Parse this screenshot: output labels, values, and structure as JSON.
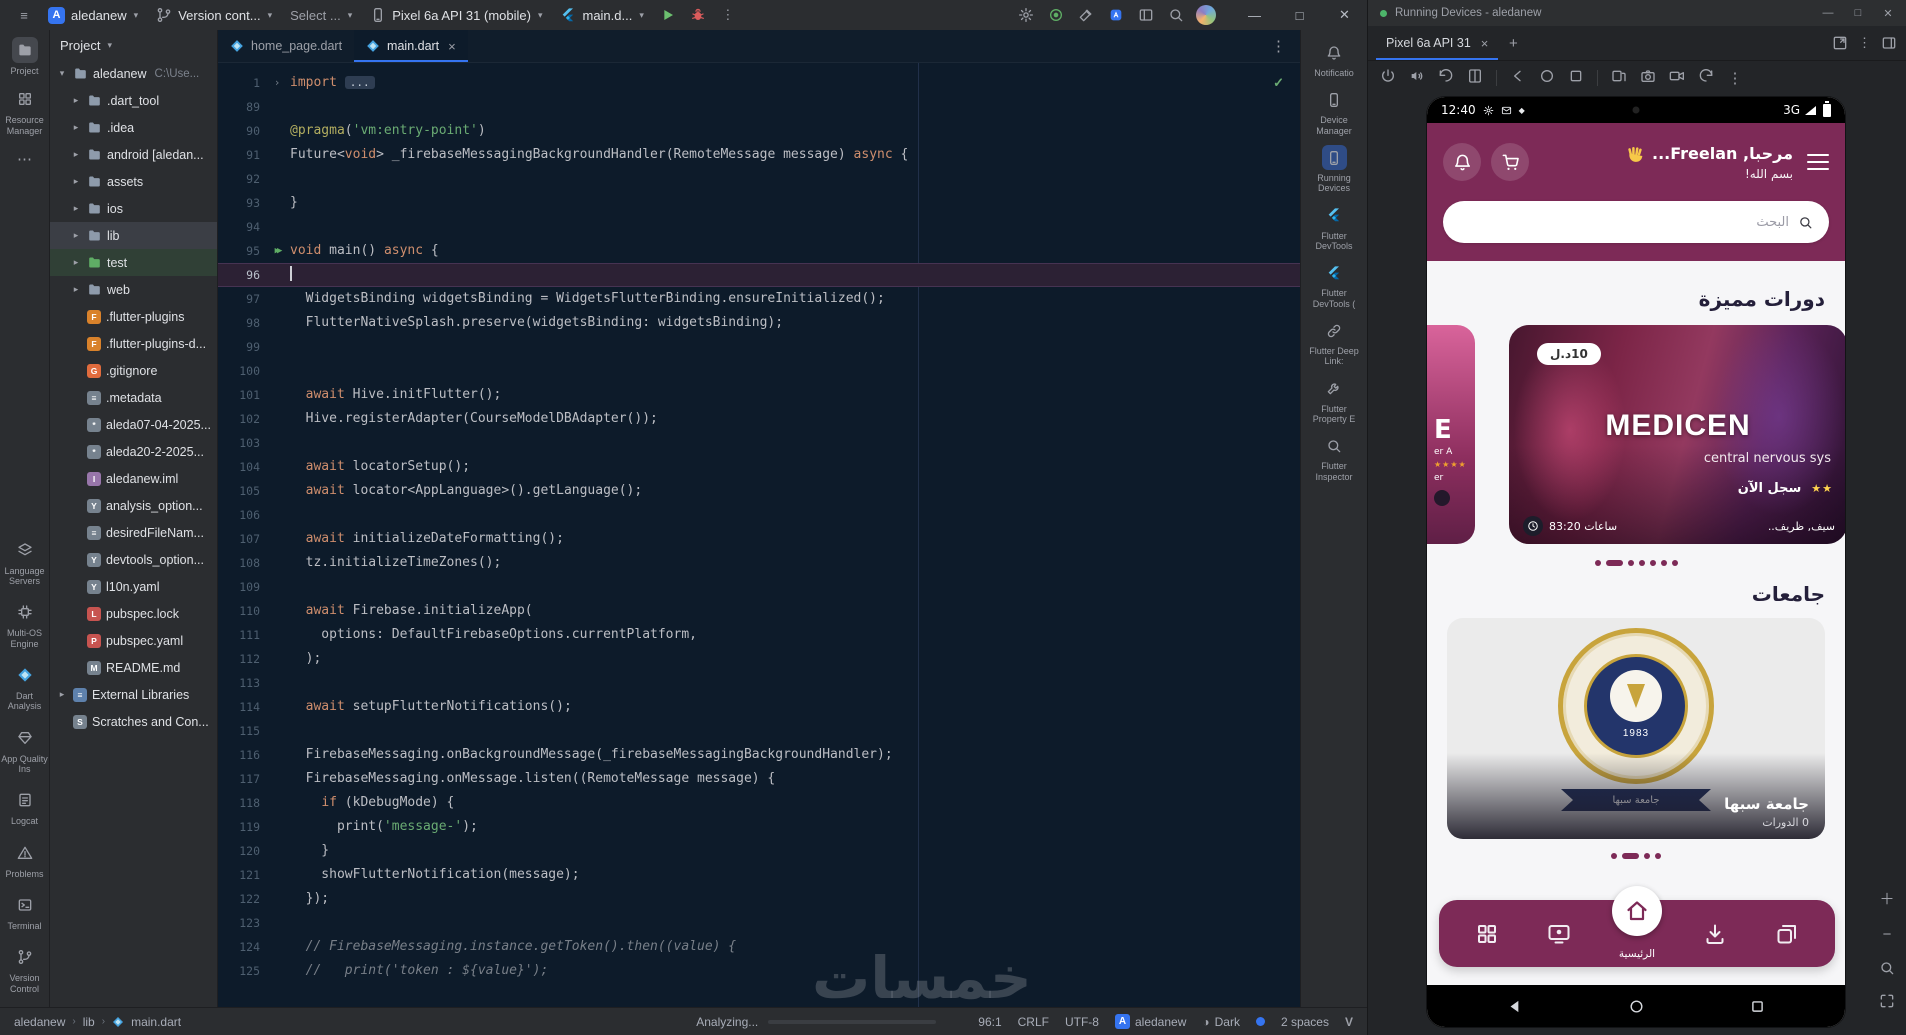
{
  "titlebar": {
    "app_initial": "A",
    "project": "aledanew",
    "branch": "Version cont...",
    "run_target": "Select ...",
    "device": "Pixel 6a API 31 (mobile)",
    "config": "main.d..."
  },
  "left_strip": {
    "top": [
      {
        "id": "project",
        "label": "Project",
        "icon": "folder",
        "active": true
      },
      {
        "id": "resource-manager",
        "label": "Resource Manager",
        "icon": "grid4"
      },
      {
        "id": "more-tool-windows",
        "label": "",
        "icon": "dots"
      }
    ],
    "bottom": [
      {
        "id": "language-servers",
        "label": "Language Servers",
        "icon": "layers"
      },
      {
        "id": "multi-os-engine",
        "label": "Multi-OS Engine",
        "icon": "chip"
      },
      {
        "id": "dart-analysis",
        "label": "Dart Analysis",
        "icon": "dartfile"
      },
      {
        "id": "app-quality-insights",
        "label": "App Quality Ins",
        "icon": "gem"
      },
      {
        "id": "logcat",
        "label": "Logcat",
        "icon": "logdoc"
      },
      {
        "id": "problems",
        "label": "Problems",
        "icon": "warn"
      },
      {
        "id": "terminal",
        "label": "Terminal",
        "icon": "term"
      },
      {
        "id": "version-control",
        "label": "Version Control",
        "icon": "branch"
      }
    ]
  },
  "project": {
    "header": "Project",
    "tree": [
      {
        "label": "aledanew",
        "suffix": "C:\\Use...",
        "depth": 0,
        "chev": "▾",
        "icon": "folder"
      },
      {
        "label": ".dart_tool",
        "depth": 1,
        "chev": "▸",
        "icon": "folder"
      },
      {
        "label": ".idea",
        "depth": 1,
        "chev": "▸",
        "icon": "folder"
      },
      {
        "label": "android [aledan...",
        "depth": 1,
        "chev": "▸",
        "icon": "folder"
      },
      {
        "label": "assets",
        "depth": 1,
        "chev": "▸",
        "icon": "folder"
      },
      {
        "label": "ios",
        "depth": 1,
        "chev": "▸",
        "icon": "folder"
      },
      {
        "label": "lib",
        "depth": 1,
        "chev": "▸",
        "icon": "folder",
        "state": "selected"
      },
      {
        "label": "test",
        "depth": 1,
        "chev": "▸",
        "icon": "folder-test",
        "state": "test"
      },
      {
        "label": "web",
        "depth": 1,
        "chev": "▸",
        "icon": "folder"
      },
      {
        "label": ".flutter-plugins",
        "depth": 1,
        "icon": "plug"
      },
      {
        "label": ".flutter-plugins-d...",
        "depth": 1,
        "icon": "plug"
      },
      {
        "label": ".gitignore",
        "depth": 1,
        "icon": "git"
      },
      {
        "label": ".metadata",
        "depth": 1,
        "icon": "file"
      },
      {
        "label": "aleda07-04-2025...",
        "depth": 1,
        "icon": "key"
      },
      {
        "label": "aleda20-2-2025...",
        "depth": 1,
        "icon": "key"
      },
      {
        "label": "aledanew.iml",
        "depth": 1,
        "icon": "iml"
      },
      {
        "label": "analysis_option...",
        "depth": 1,
        "icon": "yaml"
      },
      {
        "label": "desiredFileNam...",
        "depth": 1,
        "icon": "file"
      },
      {
        "label": "devtools_option...",
        "depth": 1,
        "icon": "yaml"
      },
      {
        "label": "l10n.yaml",
        "depth": 1,
        "icon": "yaml"
      },
      {
        "label": "pubspec.lock",
        "depth": 1,
        "icon": "lock"
      },
      {
        "label": "pubspec.yaml",
        "depth": 1,
        "icon": "pub"
      },
      {
        "label": "README.md",
        "depth": 1,
        "icon": "md"
      },
      {
        "label": "External Libraries",
        "depth": 0,
        "chev": "▸",
        "icon": "libs"
      },
      {
        "label": "Scratches and Con...",
        "depth": 0,
        "icon": "scratch"
      }
    ]
  },
  "editor": {
    "tabs": [
      {
        "label": "home_page.dart",
        "active": false,
        "closable": false
      },
      {
        "label": "main.dart",
        "active": true,
        "closable": true
      }
    ],
    "inspection_ok": "✓",
    "lines": [
      {
        "n": 1,
        "g": "fold",
        "tk": [
          [
            "import ",
            "k"
          ],
          [
            "...",
            "f"
          ]
        ]
      },
      {
        "n": 89,
        "tk": []
      },
      {
        "n": 90,
        "tk": [
          [
            "@pragma",
            "a"
          ],
          [
            "(",
            "d"
          ],
          [
            "'vm:entry-point'",
            "s"
          ],
          [
            ")",
            "d"
          ]
        ]
      },
      {
        "n": 91,
        "tk": [
          [
            "Future<",
            "d"
          ],
          [
            "void",
            "k"
          ],
          [
            "> _firebaseMessagingBackgroundHandler(RemoteMessage message) ",
            "d"
          ],
          [
            "async",
            "k"
          ],
          [
            " {",
            "d"
          ]
        ]
      },
      {
        "n": 92,
        "tk": []
      },
      {
        "n": 93,
        "tk": [
          [
            "}",
            "d"
          ]
        ]
      },
      {
        "n": 94,
        "tk": []
      },
      {
        "n": 95,
        "g": "run",
        "tk": [
          [
            "void",
            "k"
          ],
          [
            " main() ",
            "d"
          ],
          [
            "async",
            "k"
          ],
          [
            " {",
            "d"
          ]
        ]
      },
      {
        "n": 96,
        "cur": true,
        "tk": []
      },
      {
        "n": 97,
        "tk": [
          [
            "  WidgetsBinding widgetsBinding = WidgetsFlutterBinding.ensureInitialized();",
            "d"
          ]
        ]
      },
      {
        "n": 98,
        "tk": [
          [
            "  FlutterNativeSplash.preserve(widgetsBinding: widgetsBinding);",
            "d"
          ]
        ]
      },
      {
        "n": 99,
        "tk": []
      },
      {
        "n": 100,
        "tk": []
      },
      {
        "n": 101,
        "tk": [
          [
            "  ",
            "d"
          ],
          [
            "await",
            "k"
          ],
          [
            " Hive.initFlutter();",
            "d"
          ]
        ]
      },
      {
        "n": 102,
        "tk": [
          [
            "  Hive.registerAdapter(CourseModelDBAdapter());",
            "d"
          ]
        ]
      },
      {
        "n": 103,
        "tk": []
      },
      {
        "n": 104,
        "tk": [
          [
            "  ",
            "d"
          ],
          [
            "await",
            "k"
          ],
          [
            " locatorSetup();",
            "d"
          ]
        ]
      },
      {
        "n": 105,
        "tk": [
          [
            "  ",
            "d"
          ],
          [
            "await",
            "k"
          ],
          [
            " locator<AppLanguage>().getLanguage();",
            "d"
          ]
        ]
      },
      {
        "n": 106,
        "tk": []
      },
      {
        "n": 107,
        "tk": [
          [
            "  ",
            "d"
          ],
          [
            "await",
            "k"
          ],
          [
            " initializeDateFormatting();",
            "d"
          ]
        ]
      },
      {
        "n": 108,
        "tk": [
          [
            "  tz.initializeTimeZones();",
            "d"
          ]
        ]
      },
      {
        "n": 109,
        "tk": []
      },
      {
        "n": 110,
        "tk": [
          [
            "  ",
            "d"
          ],
          [
            "await",
            "k"
          ],
          [
            " Firebase.initializeApp(",
            "d"
          ]
        ]
      },
      {
        "n": 111,
        "tk": [
          [
            "    options: DefaultFirebaseOptions.currentPlatform,",
            "d"
          ]
        ]
      },
      {
        "n": 112,
        "tk": [
          [
            "  );",
            "d"
          ]
        ]
      },
      {
        "n": 113,
        "tk": []
      },
      {
        "n": 114,
        "tk": [
          [
            "  ",
            "d"
          ],
          [
            "await",
            "k"
          ],
          [
            " setupFlutterNotifications();",
            "d"
          ]
        ]
      },
      {
        "n": 115,
        "tk": []
      },
      {
        "n": 116,
        "tk": [
          [
            "  FirebaseMessaging.onBackgroundMessage(_firebaseMessagingBackgroundHandler);",
            "d"
          ]
        ]
      },
      {
        "n": 117,
        "tk": [
          [
            "  FirebaseMessaging.onMessage.listen((RemoteMessage message) {",
            "d"
          ]
        ]
      },
      {
        "n": 118,
        "tk": [
          [
            "    ",
            "d"
          ],
          [
            "if",
            "k"
          ],
          [
            " (kDebugMode) {",
            "d"
          ]
        ]
      },
      {
        "n": 119,
        "tk": [
          [
            "      print(",
            "d"
          ],
          [
            "'message-'",
            "s"
          ],
          [
            ");",
            "d"
          ]
        ]
      },
      {
        "n": 120,
        "tk": [
          [
            "    }",
            "d"
          ]
        ]
      },
      {
        "n": 121,
        "tk": [
          [
            "    showFlutterNotification(message);",
            "d"
          ]
        ]
      },
      {
        "n": 122,
        "tk": [
          [
            "  });",
            "d"
          ]
        ]
      },
      {
        "n": 123,
        "tk": []
      },
      {
        "n": 124,
        "tk": [
          [
            "  // FirebaseMessaging.instance.getToken().then((value) {",
            "c"
          ]
        ]
      },
      {
        "n": 125,
        "tk": [
          [
            "  //   print('token : ${value}');",
            "c"
          ]
        ]
      }
    ]
  },
  "status_bar": {
    "breadcrumbs": [
      "aledanew",
      "lib",
      "main.dart"
    ],
    "analyzing": "Analyzing...",
    "caret": "96:1",
    "line_ending": "CRLF",
    "encoding": "UTF-8",
    "project_badge": "A",
    "project": "aledanew",
    "theme": "Dark",
    "indent": "2 spaces",
    "plugin": "V"
  },
  "right_strip": {
    "items": [
      {
        "id": "notifications",
        "label": "Notificatio",
        "icon": "bell"
      },
      {
        "id": "device-manager",
        "label": "Device Manager",
        "icon": "phone"
      },
      {
        "id": "running-devices",
        "label": "Running Devices",
        "icon": "phone",
        "active": true
      },
      {
        "id": "flutter-devtools",
        "label": "Flutter DevTools",
        "icon": "flutter"
      },
      {
        "id": "flutter-devtools-2",
        "label": "Flutter DevTools (",
        "icon": "flutter"
      },
      {
        "id": "flutter-deep-links",
        "label": "Flutter Deep Link:",
        "icon": "link"
      },
      {
        "id": "flutter-property-editor",
        "label": "Flutter Property E",
        "icon": "wrench"
      },
      {
        "id": "flutter-inspector",
        "label": "Flutter Inspector",
        "icon": "search"
      }
    ]
  },
  "device_panel": {
    "title": "Running Devices - aledanew",
    "tab": "Pixel 6a API 31",
    "toolbar": [
      "power",
      "volume",
      "rotate",
      "fold",
      "back",
      "home-round",
      "overview",
      "mirror",
      "screenshot",
      "record",
      "restart",
      "more"
    ],
    "separators_after": [
      3,
      6
    ],
    "phone": {
      "time": "12:40",
      "network": "3G",
      "status_icons": [
        "gear",
        "mail",
        "diamond"
      ],
      "greeting": "مرحبا, Freelan...",
      "sub_greeting": "بسم الله!",
      "search_placeholder": "البحث",
      "featured_title": "دورات مميزة",
      "card": {
        "price": "10د.ل",
        "title": "MEDICEN",
        "subtitle": "central nervous sys",
        "cta": "سجل الآن",
        "stars": "★★",
        "hours": "83:20 ساعات",
        "author": "سيف, ظريف.."
      },
      "partial_card": {
        "letter": "E",
        "line1": "er A",
        "stars": "★★★★",
        "line2": "er"
      },
      "universities_title": "جامعات",
      "university": {
        "name": "جامعة سبها",
        "courses": "0 الدورات",
        "year": "1983",
        "ribbon": "جامعة سبها"
      },
      "nav_home_label": "الرئيسية",
      "nav_icons": [
        "grid4",
        "cast",
        "home5",
        "download",
        "library"
      ],
      "dots_featured": {
        "count": 7,
        "active": 1
      },
      "dots_universities": {
        "count": 4,
        "active": 1
      }
    }
  },
  "watermark": "خمسات",
  "colors": {
    "accent": "#3574F0",
    "app_primary": "#7D2A57",
    "editor_bg": "#0D1B2A",
    "star": "#F0A12E",
    "run_green": "#5FAD65"
  }
}
